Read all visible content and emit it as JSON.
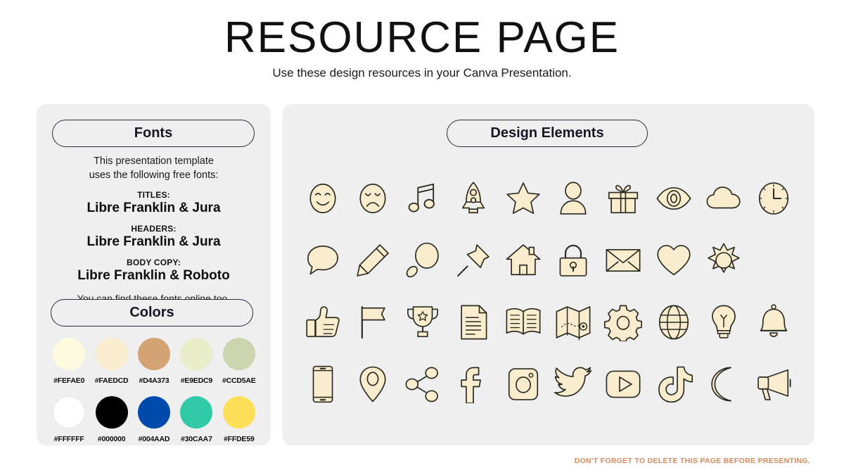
{
  "header": {
    "title": "RESOURCE PAGE",
    "subtitle": "Use these design resources in your Canva Presentation."
  },
  "fonts_panel": {
    "heading": "Fonts",
    "intro_line1": "This presentation template",
    "intro_line2": "uses the following free fonts:",
    "groups": [
      {
        "kicker": "TITLES:",
        "value": "Libre Franklin & Jura"
      },
      {
        "kicker": "HEADERS:",
        "value": "Libre Franklin & Jura"
      },
      {
        "kicker": "BODY COPY:",
        "value": "Libre Franklin & Roboto"
      }
    ],
    "footer": "You can find these fonts online too."
  },
  "colors_panel": {
    "heading": "Colors",
    "row1": [
      {
        "hex": "#FEFAE0",
        "label": "#FEFAE0"
      },
      {
        "hex": "#FAEDCD",
        "label": "#FAEDCD"
      },
      {
        "hex": "#D4A373",
        "label": "#D4A373"
      },
      {
        "hex": "#E9EDC9",
        "label": "#E9EDC9"
      },
      {
        "hex": "#CCD5AE",
        "label": "#CCD5AE"
      }
    ],
    "row2": [
      {
        "hex": "#FFFFFF",
        "label": "#FFFFFF"
      },
      {
        "hex": "#000000",
        "label": "#000000"
      },
      {
        "hex": "#004AAD",
        "label": "#004AAD"
      },
      {
        "hex": "#30CAA7",
        "label": "#30CAA7"
      },
      {
        "hex": "#FFDE59",
        "label": "#FFDE59"
      }
    ]
  },
  "design_panel": {
    "heading": "Design Elements",
    "icon_fill": "#FAEDCD",
    "icon_stroke": "#2B2B23",
    "icons": [
      "smiley-face-icon",
      "sad-face-icon",
      "music-note-icon",
      "rocket-icon",
      "star-icon",
      "person-icon",
      "gift-icon",
      "eye-icon",
      "cloud-icon",
      "clock-icon",
      "speech-bubble-icon",
      "pencil-icon",
      "magnifying-glass-icon",
      "pushpin-icon",
      "house-icon",
      "lock-icon",
      "envelope-icon",
      "heart-icon",
      "sun-icon",
      "empty-slot",
      "thumbs-up-icon",
      "flag-icon",
      "trophy-icon",
      "document-icon",
      "book-icon",
      "map-icon",
      "gear-icon",
      "globe-icon",
      "lightbulb-icon",
      "bell-icon",
      "phone-icon",
      "location-pin-icon",
      "share-icon",
      "facebook-icon",
      "instagram-icon",
      "twitter-icon",
      "youtube-icon",
      "tiktok-icon",
      "moon-icon",
      "megaphone-icon"
    ]
  },
  "footer": {
    "note": "DON'T FORGET TO DELETE THIS PAGE BEFORE PRESENTING."
  }
}
